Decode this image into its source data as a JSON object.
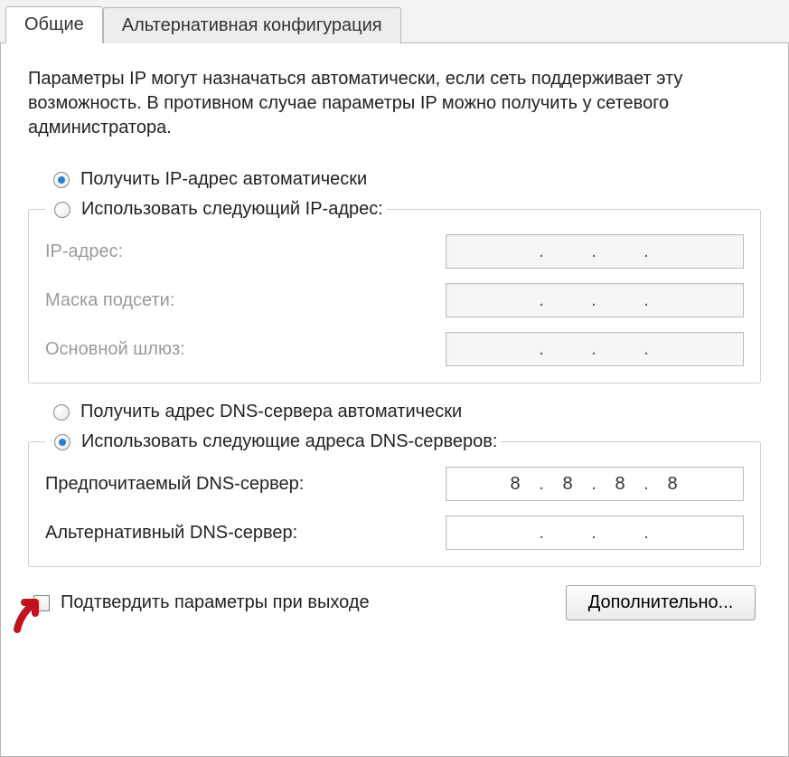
{
  "tabs": {
    "general": "Общие",
    "alternate": "Альтернативная конфигурация"
  },
  "description": "Параметры IP могут назначаться автоматически, если сеть поддерживает эту возможность. В противном случае параметры IP можно получить у сетевого администратора.",
  "ip": {
    "auto_label": "Получить IP-адрес автоматически",
    "manual_label": "Использовать следующий IP-адрес:",
    "ip_label": "IP-адрес:",
    "mask_label": "Маска подсети:",
    "gateway_label": "Основной шлюз:",
    "ip_value": [
      "",
      "",
      "",
      ""
    ],
    "mask_value": [
      "",
      "",
      "",
      ""
    ],
    "gateway_value": [
      "",
      "",
      "",
      ""
    ]
  },
  "dns": {
    "auto_label": "Получить адрес DNS-сервера автоматически",
    "manual_label": "Использовать следующие адреса DNS-серверов:",
    "preferred_label": "Предпочитаемый DNS-сервер:",
    "alternate_label": "Альтернативный DNS-сервер:",
    "preferred_value": [
      "8",
      "8",
      "8",
      "8"
    ],
    "alternate_value": [
      "",
      "",
      "",
      ""
    ]
  },
  "validate_label": "Подтвердить параметры при выходе",
  "advanced_button": "Дополнительно..."
}
